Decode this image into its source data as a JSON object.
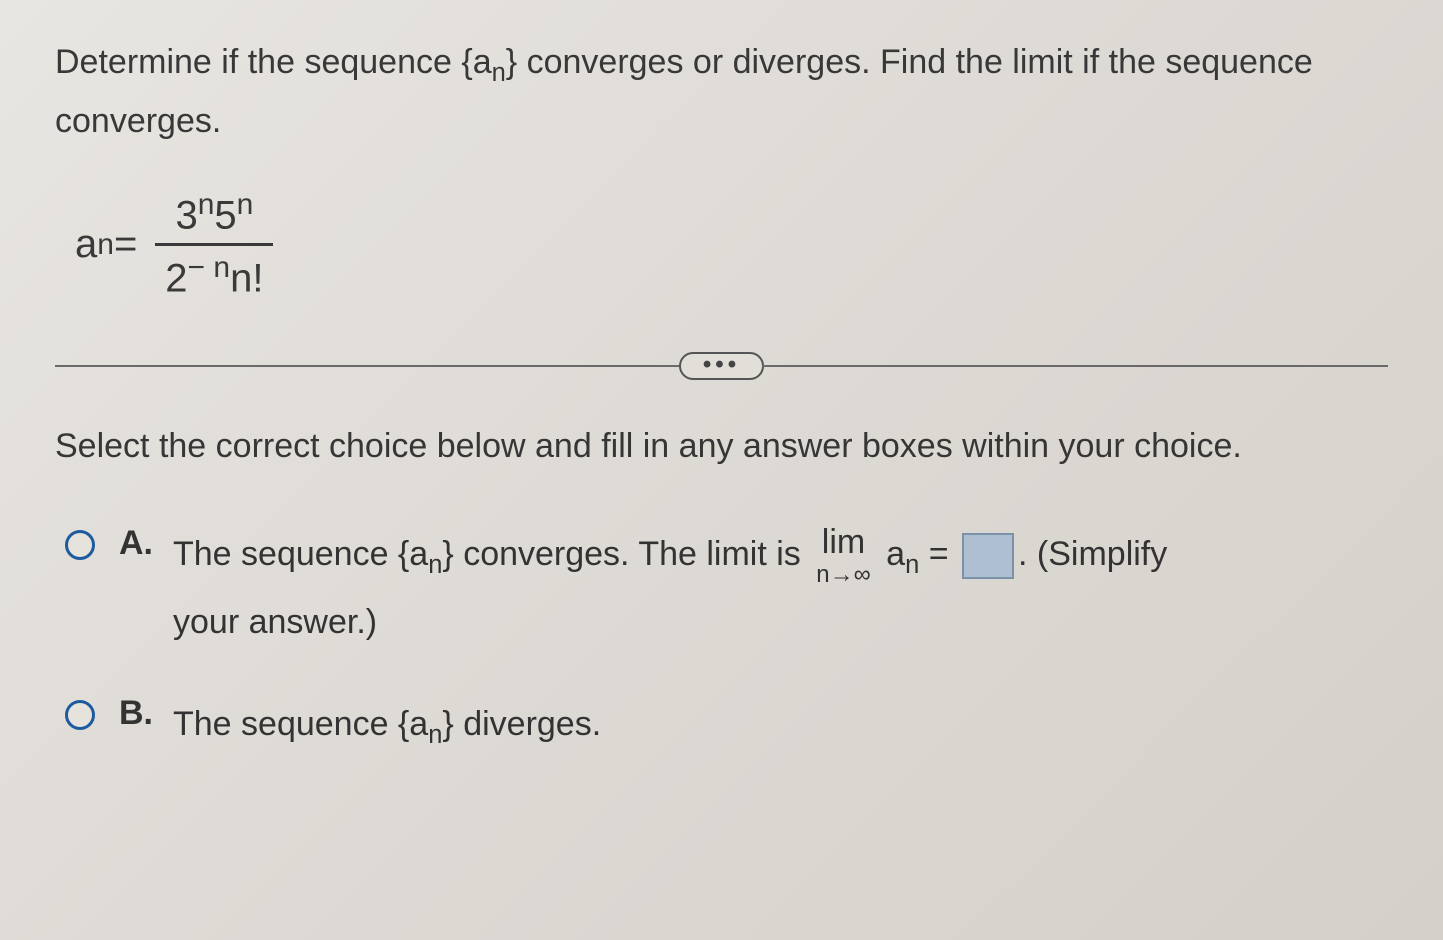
{
  "question": {
    "part1": "Determine if the sequence {a",
    "sub1": "n",
    "part2": "} converges or diverges. Find the limit if the sequence converges."
  },
  "formula": {
    "lhs_a": "a",
    "lhs_sub": "n",
    "eq": " = ",
    "num_3": "3",
    "num_sup1": "n",
    "num_5": "5",
    "num_sup2": "n",
    "den_2": "2",
    "den_sup": "− n",
    "den_nf": "n!"
  },
  "ellipsis": "•••",
  "instruction": "Select the correct choice below and fill in any answer boxes within your choice.",
  "choiceA": {
    "label": "A.",
    "t1": "The sequence {a",
    "sub1": "n",
    "t2": "} converges. The limit is ",
    "lim": "lim",
    "limsub": "n→∞",
    "a": " a",
    "asub": "n",
    "eq": " = ",
    "period": ". (Simplify",
    "line2": "your answer.)"
  },
  "choiceB": {
    "label": "B.",
    "t1": "The sequence {a",
    "sub1": "n",
    "t2": "} diverges."
  }
}
